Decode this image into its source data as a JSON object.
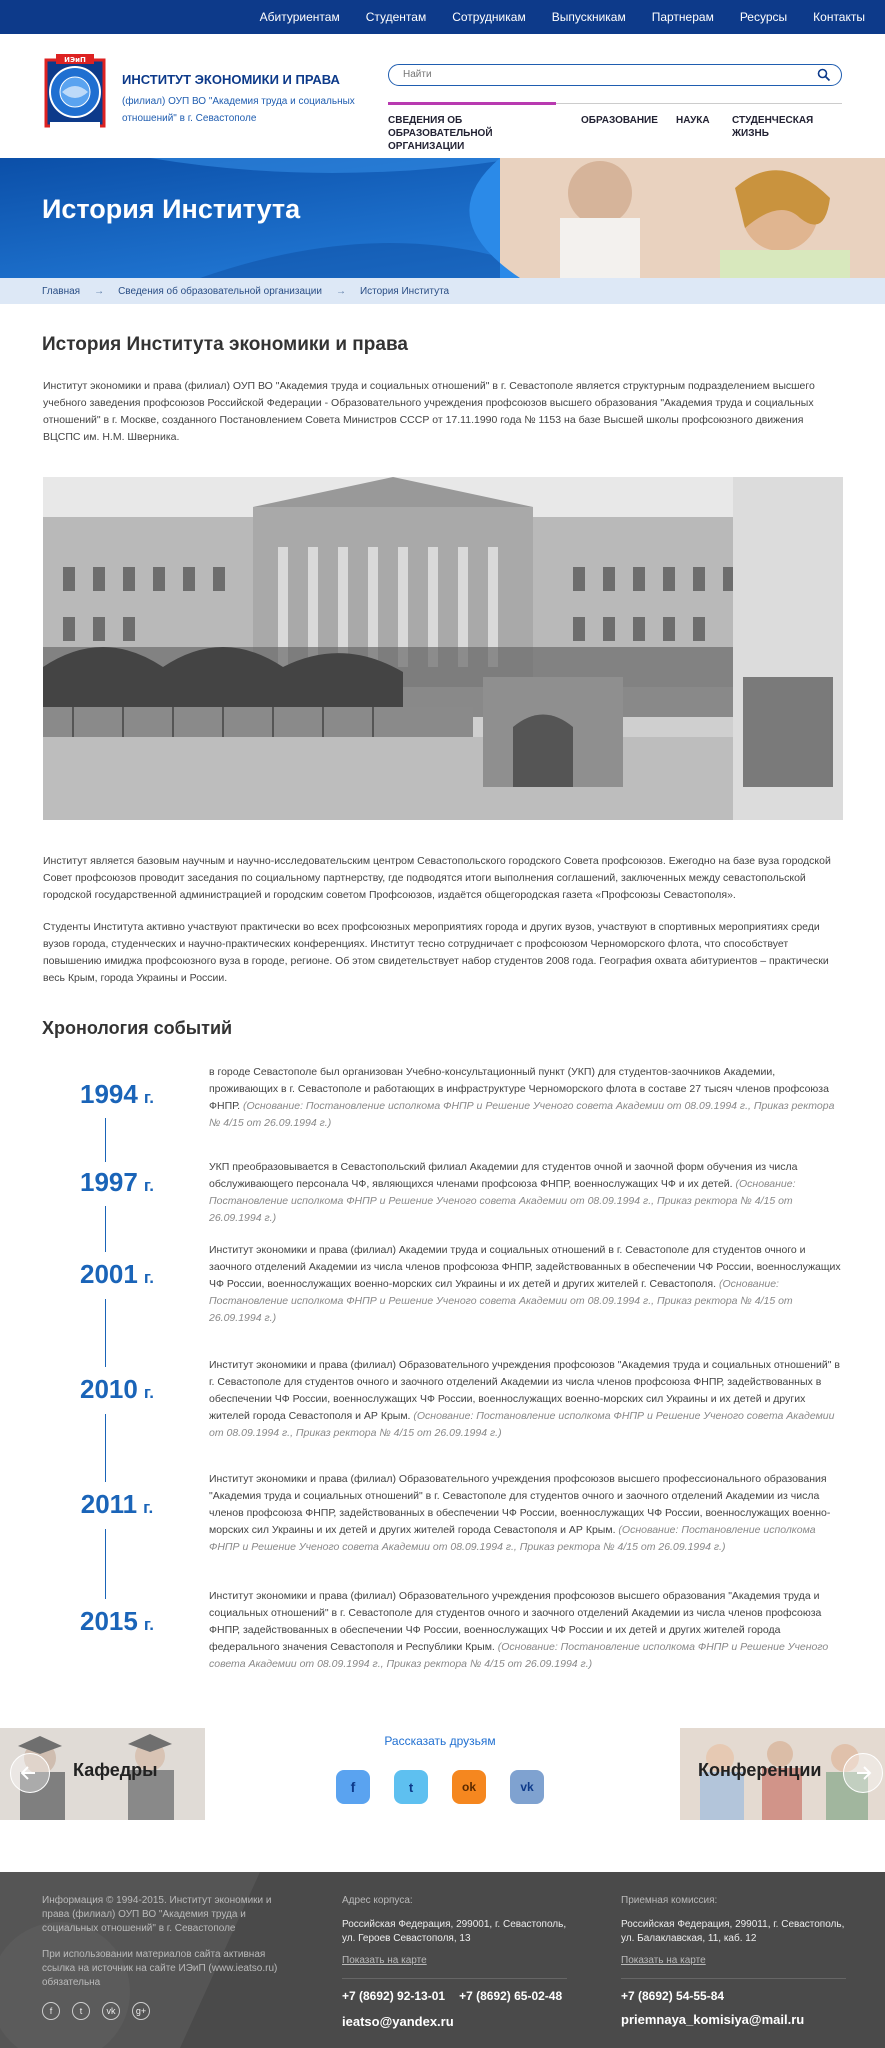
{
  "topnav": [
    "Абитуриентам",
    "Студентам",
    "Сотрудникам",
    "Выпускникам",
    "Партнерам",
    "Ресурсы",
    "Контакты"
  ],
  "brand": {
    "title": "ИНСТИТУТ ЭКОНОМИКИ И ПРАВА",
    "subtitle": "(филиал) ОУП ВО \"Академия труда и социальных отношений\" в г. Севастополе",
    "logo_text": "ИЭиП"
  },
  "search": {
    "placeholder": "Найти"
  },
  "mainnav": [
    "СВЕДЕНИЯ ОБ ОБРАЗОВАТЕЛЬНОЙ ОРГАНИЗАЦИИ",
    "ОБРАЗОВАНИЕ",
    "НАУКА",
    "СТУДЕНЧЕСКАЯ ЖИЗНЬ"
  ],
  "hero": {
    "title": "История Института"
  },
  "breadcrumbs": [
    "Главная",
    "Сведения об образовательной организации",
    "История Института"
  ],
  "page": {
    "heading": "История Института экономики и права",
    "intro": "Институт экономики и права (филиал) ОУП ВО \"Академия труда и социальных отношений\" в г. Севастополе является структурным подразделением высшего учебного заведения профсоюзов Российской Федерации - Образовательного учреждения профсоюзов высшего образования \"Академия труда и социальных отношений\" в г. Москве, созданного Постановлением Совета Министров СССР от 17.11.1990 года № 1153 на базе Высшей школы профсоюзного движения ВЦСПС им. Н.М. Шверника.",
    "para2": "Институт является базовым научным и научно-исследовательским центром Севастопольского городского Совета профсоюзов. Ежегодно на базе вуза городской Совет профсоюзов проводит заседания по социальному партнерству, где подводятся итоги выполнения соглашений, заключенных между севастопольской городской государственной администрацией и городским советом Профсоюзов, издаётся общегородская газета «Профсоюзы Севастополя».",
    "para3": "Студенты Института активно участвуют практически во всех профсоюзных мероприятиях города и других вузов, участвуют в спортивных мероприятиях среди вузов города, студенческих и научно-практических конференциях. Институт тесно сотрудничает с профсоюзом Черноморского флота, что способствует повышению имиджа профсоюзного вуза в городе, регионе. Об этом свидетельствует набор студентов 2008 года. География охвата абитуриентов – практически весь Крым, города Украины и России.",
    "chronology_heading": "Хронология событий"
  },
  "timeline": [
    {
      "year": "1994",
      "suffix": "г.",
      "text": "в городе Севастополе был организован Учебно-консультационный пункт (УКП) для студентов-заочников Академии, проживающих в г. Севастополе и работающих в инфраструктуре Черноморского флота в составе 27 тысяч членов профсоюза ФНПР.",
      "note": "(Основание: Постановление исполкома ФНПР и Решение Ученого совета Академии от 08.09.1994 г., Приказ ректора № 4/15 от 26.09.1994 г.)"
    },
    {
      "year": "1997",
      "suffix": "г.",
      "text": "УКП преобразовывается в Севастопольский филиал Академии для студентов очной и заочной форм обучения из числа обслуживающего персонала ЧФ, являющихся членами профсоюза ФНПР, военнослужащих ЧФ и их детей.",
      "note": "(Основание: Постановление исполкома ФНПР и Решение Ученого совета Академии от 08.09.1994 г., Приказ ректора № 4/15 от 26.09.1994 г.)"
    },
    {
      "year": "2001",
      "suffix": "г.",
      "text": "Институт экономики и права (филиал) Академии труда и социальных отношений в г. Севастополе для студентов очного и заочного отделений Академии из числа членов профсоюза ФНПР, задействованных в обеспечении ЧФ России, военнослужащих ЧФ России, военнослужащих военно-морских сил Украины и их детей и других жителей г. Севастополя.",
      "note": "(Основание: Постановление исполкома ФНПР и Решение Ученого совета Академии от 08.09.1994 г., Приказ ректора № 4/15 от 26.09.1994 г.)"
    },
    {
      "year": "2010",
      "suffix": "г.",
      "text": "Институт экономики и права (филиал) Образовательного учреждения профсоюзов \"Академия труда и социальных отношений\" в г. Севастополе для студентов очного и заочного отделений Академии из числа членов профсоюза ФНПР, задействованных в обеспечении ЧФ России, военнослужащих ЧФ России, военнослужащих военно-морских сил Украины и их детей и других жителей города Севастополя и АР Крым.",
      "note": "(Основание: Постановление исполкома ФНПР и Решение Ученого совета Академии от 08.09.1994 г., Приказ ректора № 4/15 от 26.09.1994 г.)"
    },
    {
      "year": "2011",
      "suffix": "г.",
      "text": "Институт экономики и права (филиал) Образовательного учреждения профсоюзов высшего профессионального образования \"Академия труда и социальных отношений\" в г. Севастополе для студентов очного и заочного отделений Академии из числа членов профсоюза ФНПР, задействованных в обеспечении ЧФ России, военнослужащих ЧФ России, военнослужащих военно-морских сил Украины и их детей и других жителей города Севастополя и АР Крым.",
      "note": "(Основание: Постановление исполкома ФНПР и Решение Ученого совета Академии от 08.09.1994 г., Приказ ректора № 4/15 от 26.09.1994 г.)"
    },
    {
      "year": "2015",
      "suffix": "г.",
      "text": "Институт экономики и права (филиал) Образовательного учреждения профсоюзов высшего образования \"Академия труда и социальных отношений\" в г. Севастополе для студентов очного и заочного отделений Академии из числа членов профсоюза ФНПР, задействованных в обеспечении ЧФ России, военнослужащих ЧФ России и их детей и других жителей города федерального значения Севастополя и Республики Крым.",
      "note": "(Основание: Постановление исполкома ФНПР и Решение Ученого совета Академии от 08.09.1994 г., Приказ ректора № 4/15 от 26.09.1994 г.)"
    }
  ],
  "bottom": {
    "left_card": "Кафедры",
    "right_card": "Конференции",
    "share_title": "Рассказать друзьям",
    "share_icons": [
      "f",
      "t",
      "ok",
      "vk"
    ]
  },
  "footer": {
    "info": "Информация © 1994-2015. Институт экономики и права (филиал) ОУП ВО \"Академия труда и социальных отношений\" в г. Севастополе",
    "notice": "При использовании материалов сайта активная ссылка на источник на сайте ИЭиП (www.ieatso.ru) обязательна",
    "social": [
      "f",
      "t",
      "vk",
      "g+"
    ],
    "address_label": "Адрес корпуса:",
    "address": "Российская Федерация, 299001, г. Севастополь, ул. Героев Севастополя, 13",
    "map_link": "Показать на карте",
    "phone1": "+7 (8692) 92-13-01",
    "phone2": "+7 (8692) 65-02-48",
    "email1": "ieatso@yandex.ru",
    "admission_label": "Приемная комиссия:",
    "admission_address": "Российская Федерация, 299011, г. Севастополь, ул. Балаклавская, 11, каб. 12",
    "map_link2": "Показать на карте",
    "phone3": "+7 (8692) 54-55-84",
    "email2": "priemnaya_komisiya@mail.ru"
  }
}
